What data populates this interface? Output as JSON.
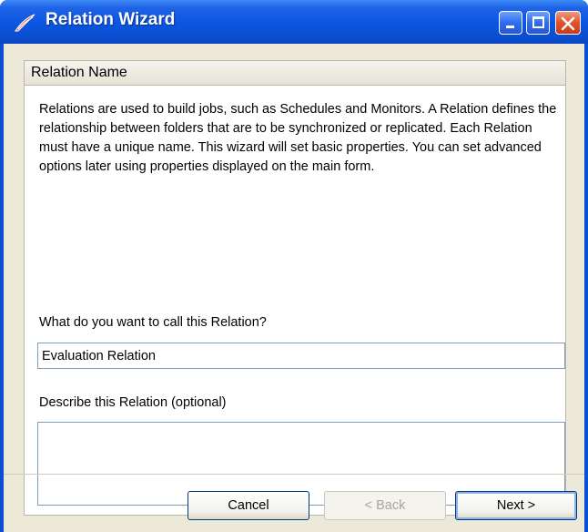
{
  "window": {
    "title": "Relation Wizard",
    "icon": "app-logo-icon",
    "controls": [
      "minimize-icon",
      "maximize-icon",
      "close-icon"
    ]
  },
  "section": {
    "title": "Relation Name"
  },
  "description": "Relations are used to build jobs, such as Schedules and Monitors. A Relation defines the relationship between folders that are to be synchronized or replicated. Each Relation must have a unique name.  This wizard will set basic properties. You can set advanced options later using properties displayed on the main form.",
  "name_field": {
    "label": "What do you want to call this Relation?",
    "value": "Evaluation Relation"
  },
  "desc_field": {
    "label": "Describe this Relation (optional)",
    "value": ""
  },
  "buttons": {
    "cancel": "Cancel",
    "back": "< Back",
    "next": "Next >"
  }
}
